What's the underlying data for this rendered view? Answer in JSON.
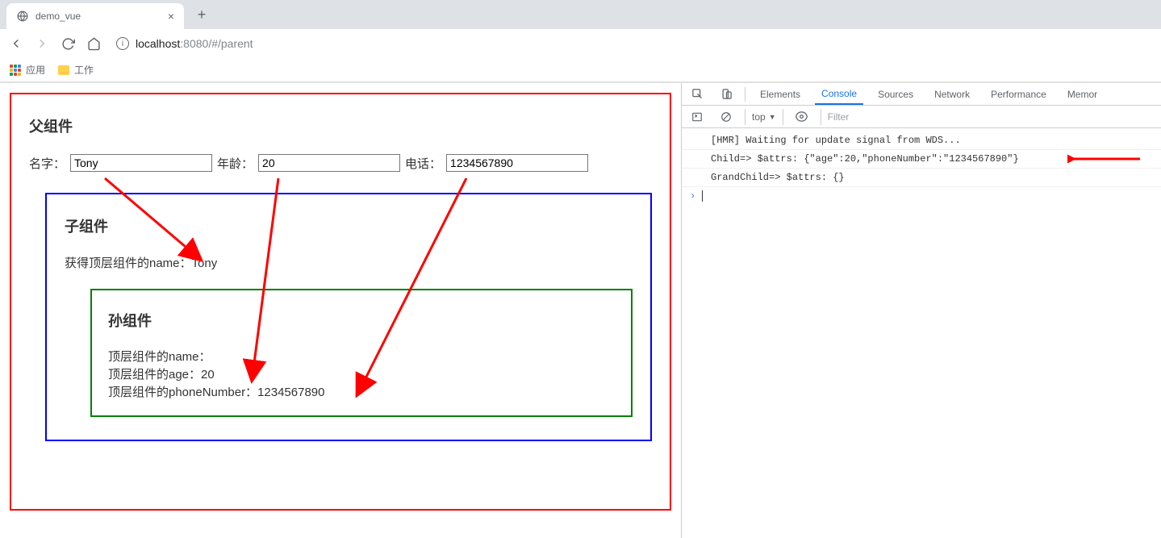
{
  "browser": {
    "tab_title": "demo_vue",
    "url_host": "localhost",
    "url_port": ":8080",
    "url_path": "/#/parent",
    "bookmarks": {
      "apps_label": "应用",
      "folder_label": "工作"
    }
  },
  "page": {
    "parent_title": "父组件",
    "labels": {
      "name": "名字：",
      "age": "年龄：",
      "phone": "电话："
    },
    "inputs": {
      "name": "Tony",
      "age": "20",
      "phone": "1234567890"
    },
    "child_title": "子组件",
    "child_text_prefix": "获得顶层组件的name：",
    "child_text_value": "Tony",
    "grand_title": "孙组件",
    "grand_lines": {
      "name_prefix": "顶层组件的name：",
      "name_value": "",
      "age_prefix": "顶层组件的age：",
      "age_value": "20",
      "phone_prefix": "顶层组件的phoneNumber：",
      "phone_value": "1234567890"
    }
  },
  "devtools": {
    "tabs": {
      "elements": "Elements",
      "console": "Console",
      "sources": "Sources",
      "network": "Network",
      "performance": "Performance",
      "memory": "Memor"
    },
    "context": "top",
    "filter_placeholder": "Filter",
    "console_lines": [
      "[HMR] Waiting for update signal from WDS...",
      "Child=> $attrs: {\"age\":20,\"phoneNumber\":\"1234567890\"}",
      "GrandChild=> $attrs: {}"
    ]
  }
}
